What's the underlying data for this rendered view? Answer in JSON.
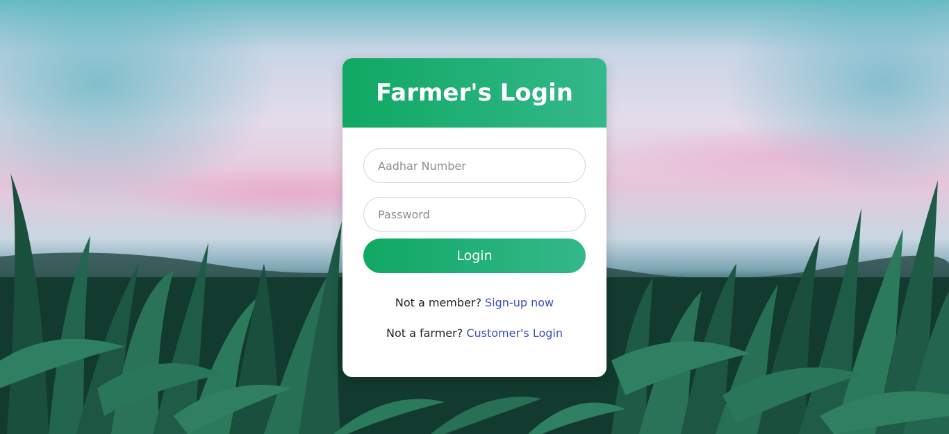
{
  "login_card": {
    "title": "Farmer's Login",
    "aadhar_placeholder": "Aadhar Number",
    "password_placeholder": "Password",
    "login_label": "Login",
    "signup_prompt": "Not a member?",
    "signup_link": "Sign-up now",
    "customer_prompt": "Not a farmer?",
    "customer_link": "Customer's Login"
  },
  "colors": {
    "accent_start": "#10a863",
    "accent_end": "#34b88a",
    "link": "#3b4fb8"
  }
}
